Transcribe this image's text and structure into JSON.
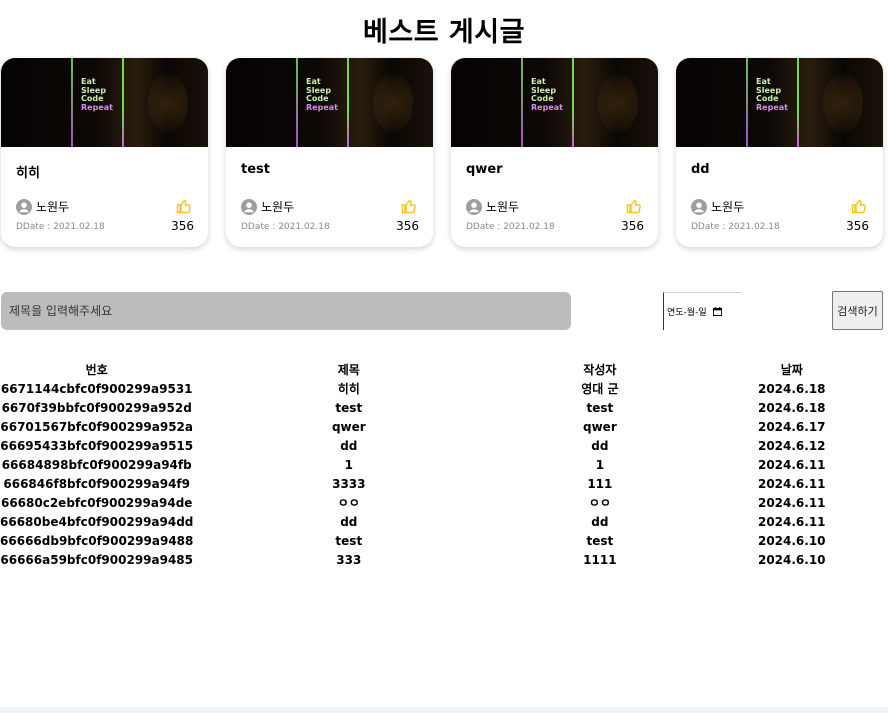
{
  "page": {
    "title": "베스트 게시글"
  },
  "image_text": {
    "line1": "Eat",
    "line2": "Sleep",
    "line3": "Code",
    "line4": "Repeat"
  },
  "cards": [
    {
      "title": "히히",
      "author": "노원두",
      "date": "DDate : 2021.02.18",
      "likes": "356"
    },
    {
      "title": "test",
      "author": "노원두",
      "date": "DDate : 2021.02.18",
      "likes": "356"
    },
    {
      "title": "qwer",
      "author": "노원두",
      "date": "DDate : 2021.02.18",
      "likes": "356"
    },
    {
      "title": "dd",
      "author": "노원두",
      "date": "DDate : 2021.02.18",
      "likes": "356"
    }
  ],
  "search": {
    "placeholder": "제목을 입력해주세요",
    "date_placeholder": "연도-월-일",
    "button_label": "검색하기"
  },
  "table": {
    "headers": [
      "번호",
      "제목",
      "작성자",
      "날짜"
    ],
    "rows": [
      [
        "6671144cbfc0f900299a9531",
        "히히",
        "영대 군",
        "2024.6.18"
      ],
      [
        "6670f39bbfc0f900299a952d",
        "test",
        "test",
        "2024.6.18"
      ],
      [
        "66701567bfc0f900299a952a",
        "qwer",
        "qwer",
        "2024.6.17"
      ],
      [
        "66695433bfc0f900299a9515",
        "dd",
        "dd",
        "2024.6.12"
      ],
      [
        "66684898bfc0f900299a94fb",
        "1",
        "1",
        "2024.6.11"
      ],
      [
        "666846f8bfc0f900299a94f9",
        "3333",
        "111",
        "2024.6.11"
      ],
      [
        "66680c2ebfc0f900299a94de",
        "ㅇㅇ",
        "ㅇㅇ",
        "2024.6.11"
      ],
      [
        "66680be4bfc0f900299a94dd",
        "dd",
        "dd",
        "2024.6.11"
      ],
      [
        "66666db9bfc0f900299a9488",
        "test",
        "test",
        "2024.6.10"
      ],
      [
        "66666a59bfc0f900299a9485",
        "333",
        "1111",
        "2024.6.10"
      ]
    ]
  },
  "colors": {
    "like_icon": "#f5c518",
    "search_bg": "#bcbcbc",
    "avatar": "#9e9e9e"
  },
  "icons": {
    "avatar": "user-avatar-icon",
    "like": "thumbs-up-icon",
    "calendar": "calendar-icon"
  }
}
